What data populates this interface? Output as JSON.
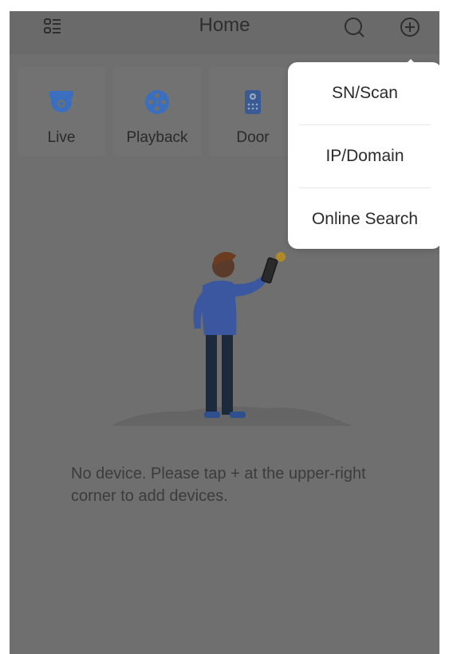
{
  "header": {
    "title": "Home",
    "menu_icon": "device-list-icon",
    "search_icon": "search-icon",
    "add_icon": "add-circle-icon"
  },
  "tiles": [
    {
      "label": "Live",
      "icon": "camera-icon",
      "color": "#3a6fc0"
    },
    {
      "label": "Playback",
      "icon": "playback-reel-icon",
      "color": "#3a6fc0"
    },
    {
      "label": "Door",
      "icon": "door-intercom-icon",
      "color": "#3a5a96"
    }
  ],
  "empty_state": {
    "message": "No device. Please tap + at the upper-right corner to add devices."
  },
  "add_menu": {
    "items": [
      "SN/Scan",
      "IP/Domain",
      "Online Search"
    ]
  },
  "colors": {
    "overlay_background": "#6f6f6f",
    "popup_background": "#ffffff",
    "accent_blue": "#3a6fc0"
  }
}
